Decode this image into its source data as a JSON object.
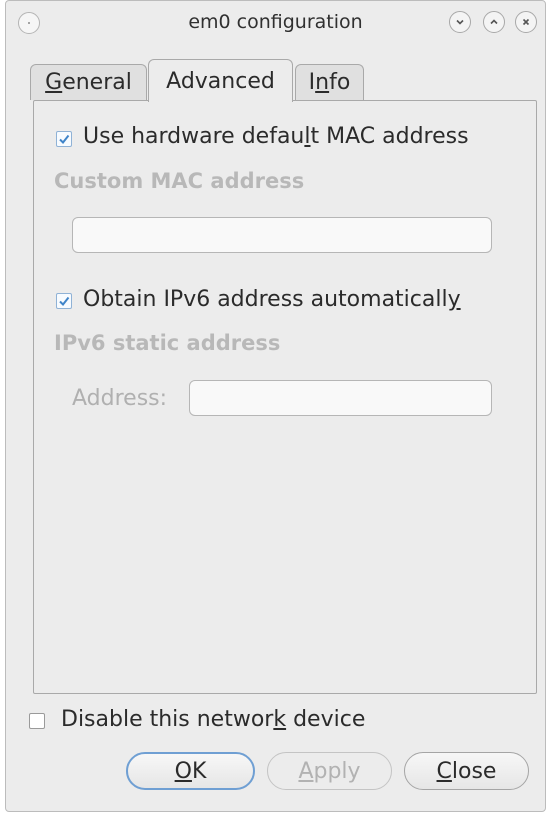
{
  "window": {
    "title": "em0 configuration",
    "controls": [
      "minimize-icon",
      "maximize-icon",
      "close-icon"
    ]
  },
  "tabs": [
    {
      "prefix": "",
      "mnemonic": "G",
      "suffix": "eneral",
      "active": false
    },
    {
      "prefix": "",
      "mnemonic": "",
      "suffix": "Advanced",
      "active": true
    },
    {
      "prefix": "I",
      "mnemonic": "n",
      "suffix": "fo",
      "active": false
    }
  ],
  "advanced": {
    "mac_checkbox": {
      "prefix": "Use hardware defau",
      "mnemonic": "l",
      "suffix": "t MAC address",
      "checked": true
    },
    "custom_mac_heading": "Custom MAC address",
    "custom_mac_field": {
      "value": ""
    },
    "ipv6_checkbox": {
      "prefix": "Obtain IPv6 address automaticall",
      "mnemonic": "y",
      "suffix": "",
      "checked": true
    },
    "ipv6_heading": "IPv6 static address",
    "address_label": "Address:",
    "address_field": {
      "value": ""
    }
  },
  "disable_checkbox": {
    "prefix": "Disable this networ",
    "mnemonic": "k",
    "suffix": " device",
    "checked": false
  },
  "buttons": {
    "ok": {
      "mnemonic": "O",
      "suffix": "K"
    },
    "apply": {
      "mnemonic": "A",
      "suffix": "pply",
      "enabled": false
    },
    "close": {
      "mnemonic": "C",
      "suffix": "lose"
    }
  },
  "colors": {
    "accent": "#6f9fd3",
    "check": "#3f84c9",
    "disabled_text": "#b0b0b0"
  }
}
